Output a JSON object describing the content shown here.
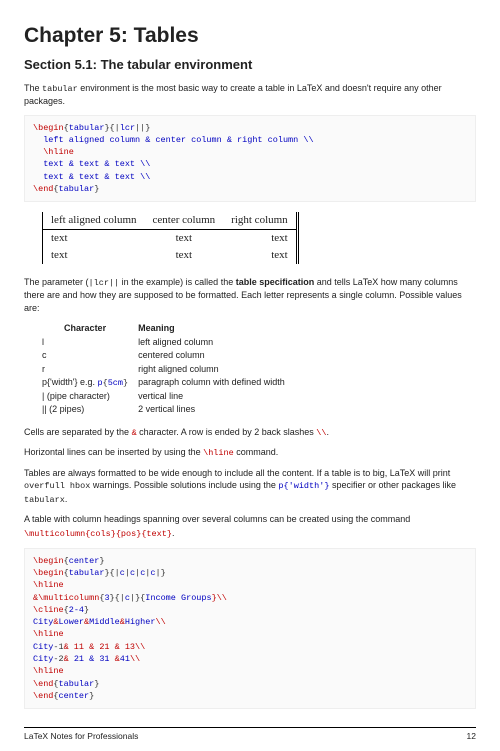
{
  "chapter_title": "Chapter 5: Tables",
  "section_title": "Section 5.1: The tabular environment",
  "intro": "The tabular environment is the most basic way to create a table in LaTeX and doesn't require any other packages.",
  "code1": {
    "l1a": "\\begin",
    "l1b": "{",
    "l1c": "tabular",
    "l1d": "}{|",
    "l1e": "lcr",
    "l1f": "||}",
    "l2": "  left aligned column & center column & right column \\\\",
    "l3": "  \\hline",
    "l4": "  text & text & text \\\\",
    "l5": "  text & text & text \\\\",
    "l6a": "\\end",
    "l6b": "{",
    "l6c": "tabular",
    "l6d": "}"
  },
  "serif": {
    "h1": "left aligned column",
    "h2": "center column",
    "h3": "right column",
    "c": "text"
  },
  "para2a": "The parameter (",
  "para2b": "|lcr||",
  "para2c": " in the example) is called the ",
  "para2d": "table specification",
  "para2e": " and tells LaTeX how many columns there are and how they are supposed to be formatted. Each letter represents a single column. Possible values are:",
  "chars": {
    "h1": "Character",
    "h2": "Meaning",
    "r1a": "l",
    "r1b": "left aligned column",
    "r2a": "c",
    "r2b": "centered column",
    "r3a": "r",
    "r3b": "right aligned column",
    "r4a": "p{'width'} e.g. ",
    "r4a2": "p{5cm}",
    "r4b": "paragraph column with defined width",
    "r5a": "| (pipe character)",
    "r5b": "vertical line",
    "r6a": "|| (2 pipes)",
    "r6b": "2 vertical lines"
  },
  "para3a": "Cells are separated by the ",
  "para3b": "&",
  "para3c": " character. A row is ended by 2 back slashes ",
  "para3d": "\\\\",
  "para3e": ".",
  "para4a": "Horizontal lines can be inserted by using the ",
  "para4b": "\\hline",
  "para4c": " command.",
  "para5a": "Tables are always formatted to be wide enough to include all the content. If a table is to big, LaTeX will print ",
  "para5b": "overfull hbox",
  "para5c": " warnings. Possible solutions include using the ",
  "para5d": "p{'width'}",
  "para5e": " specifier or other packages like ",
  "para5f": "tabularx",
  "para5g": ".",
  "para6a": "A table with column headings spanning over several columns can be created using the command ",
  "para6b": "\\multicolumn{cols}{pos}{text}",
  "para6c": ".",
  "code2": {
    "l1a": "\\begin",
    "l1b": "{",
    "l1c": "center",
    "l1d": "}",
    "l2a": "\\begin",
    "l2b": "{",
    "l2c": "tabular",
    "l2d": "}{|",
    "l2e": "c",
    "l2f": "|",
    "l2g": "c",
    "l2h": "|",
    "l2i": "c",
    "l2j": "|",
    "l2k": "c",
    "l2l": "|}",
    "l3": "\\hline",
    "l4a": "&",
    "l4b": "\\multicolumn",
    "l4c": "{",
    "l4d": "3",
    "l4e": "}{|",
    "l4f": "c",
    "l4g": "|}{",
    "l4h": "Income Groups",
    "l4i": "}\\\\",
    "l5a": "\\cline",
    "l5b": "{",
    "l5c": "2-4",
    "l5d": "}",
    "l6a": "City",
    "l6b": "&",
    "l6c": "Lower",
    "l6d": "&",
    "l6e": "Middle",
    "l6f": "&",
    "l6g": "Higher",
    "l6h": "\\\\",
    "l7": "\\hline",
    "l8a": "City",
    "l8b": "-1",
    "l8c": "& 11 & 21 & 13",
    "l8d": "\\\\",
    "l9a": "City",
    "l9b": "-2",
    "l9c": "&",
    "l9d": " 21 & 31 ",
    "l9e": "&",
    "l9f": "41",
    "l9g": "\\\\",
    "l10": "\\hline",
    "l11a": "\\end",
    "l11b": "{",
    "l11c": "tabular",
    "l11d": "}",
    "l12a": "\\end",
    "l12b": "{",
    "l12c": "center",
    "l12d": "}"
  },
  "footer_left": "LaTeX Notes for Professionals",
  "footer_right": "12"
}
